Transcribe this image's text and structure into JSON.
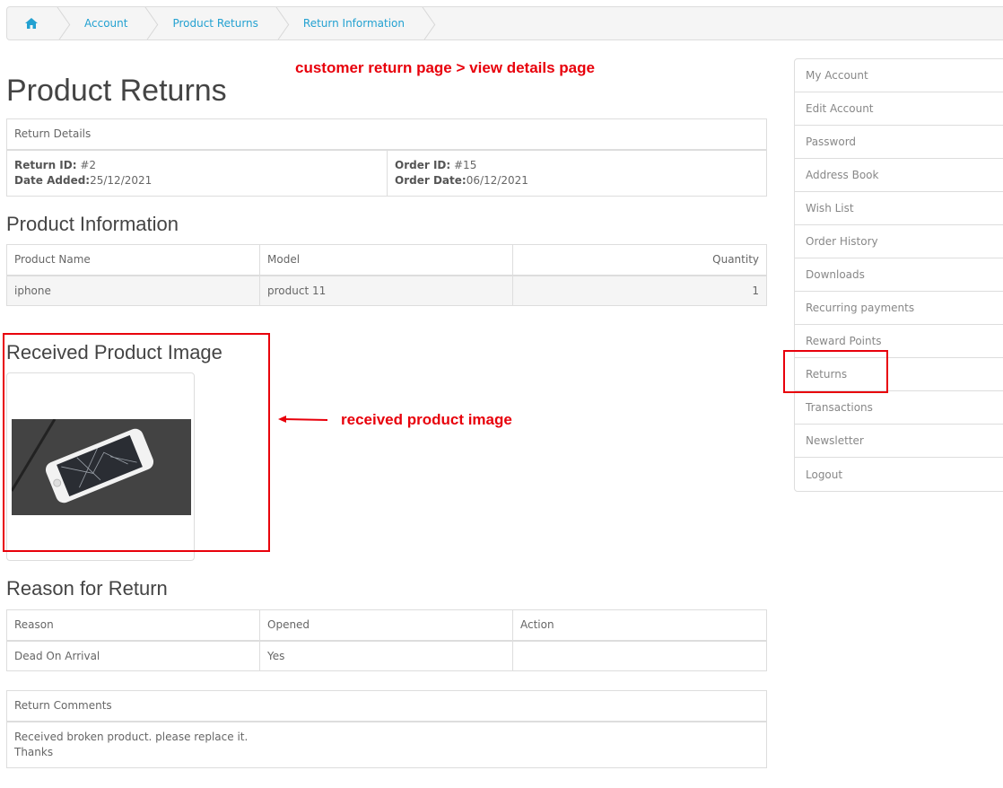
{
  "breadcrumb": {
    "home_icon": "home-icon",
    "items": [
      "Account",
      "Product Returns",
      "Return Information"
    ]
  },
  "annotations": {
    "top": "customer return page > view details page",
    "image": "received product image",
    "color": "#e8000b"
  },
  "page_title": "Product Returns",
  "return_details": {
    "header": "Return Details",
    "return_id_label": "Return ID:",
    "return_id": "#2",
    "date_added_label": "Date Added:",
    "date_added": "25/12/2021",
    "order_id_label": "Order ID:",
    "order_id": "#15",
    "order_date_label": "Order Date:",
    "order_date": "06/12/2021"
  },
  "product_info": {
    "title": "Product Information",
    "columns": [
      "Product Name",
      "Model",
      "Quantity"
    ],
    "rows": [
      [
        "iphone",
        "product 11",
        "1"
      ]
    ]
  },
  "received_image": {
    "title": "Received Product Image",
    "image_icon": "broken-phone-photo"
  },
  "reason": {
    "title": "Reason for Return",
    "columns": [
      "Reason",
      "Opened",
      "Action"
    ],
    "rows": [
      [
        "Dead On Arrival",
        "Yes",
        ""
      ]
    ]
  },
  "comments": {
    "header": "Return Comments",
    "line1": "Received broken product. please replace it.",
    "line2": "Thanks"
  },
  "sidebar": {
    "items": [
      "My Account",
      "Edit Account",
      "Password",
      "Address Book",
      "Wish List",
      "Order History",
      "Downloads",
      "Recurring payments",
      "Reward Points",
      "Returns",
      "Transactions",
      "Newsletter",
      "Logout"
    ]
  },
  "colors": {
    "link": "#23a1d1",
    "border": "#dddddd",
    "annotation": "#e8000b"
  }
}
